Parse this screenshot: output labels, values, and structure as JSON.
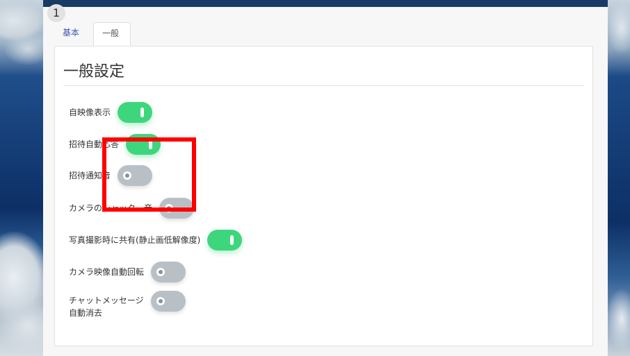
{
  "page": {
    "number_badge": "1"
  },
  "tabs": [
    {
      "label": "基本"
    },
    {
      "label": "一般"
    }
  ],
  "card": {
    "title": "一般設定",
    "settings": [
      {
        "label": "自映像表示",
        "state": "on"
      },
      {
        "label": "招待自動応答",
        "state": "on"
      },
      {
        "label": "招待通知音",
        "state": "off"
      },
      {
        "label": "カメラのシャッター音",
        "state": "off"
      },
      {
        "label": "写真撮影時に共有(静止画低解像度)",
        "state": "on"
      },
      {
        "label": "カメラ映像自動回転",
        "state": "off"
      },
      {
        "label_line1": "チャットメッセージ",
        "label_line2": "自動消去",
        "state": "off"
      }
    ]
  },
  "colors": {
    "toggle_on": "#3ed67c",
    "toggle_off": "#b8c0c6",
    "tab_active_text": "#3f51b5",
    "highlight": "#ff0000"
  }
}
